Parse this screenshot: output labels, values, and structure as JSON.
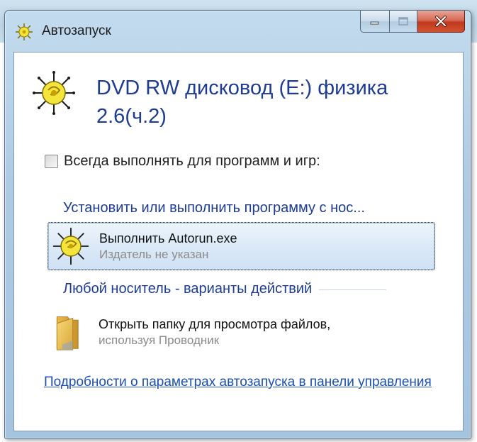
{
  "window": {
    "title": "Автозапуск",
    "controls": {
      "minimize": "minimize",
      "maximize": "maximize",
      "close": "close"
    }
  },
  "header": {
    "title": "DVD RW дисковод (E:) физика 2.6(ч.2)"
  },
  "always": {
    "label": "Всегда выполнять для программ и игр:",
    "checked": false
  },
  "sections": [
    {
      "title": "Установить или выполнить программу с нос...",
      "options": [
        {
          "label": "Выполнить Autorun.exe",
          "sub": "Издатель не указан",
          "icon": "autorun-icon",
          "selected": true
        }
      ]
    },
    {
      "title": "Любой носитель - варианты действий",
      "options": [
        {
          "label": "Открыть папку для просмотра файлов,",
          "sub": "используя Проводник",
          "icon": "folder-icon",
          "selected": false
        }
      ]
    }
  ],
  "footer": {
    "link": "Подробности о параметрах автозапуска в панели управления"
  },
  "colors": {
    "accent_text": "#1d3c92",
    "link": "#1b4fb0",
    "close_button": "#c0391e",
    "selection_bg": "#dbe9f7"
  }
}
